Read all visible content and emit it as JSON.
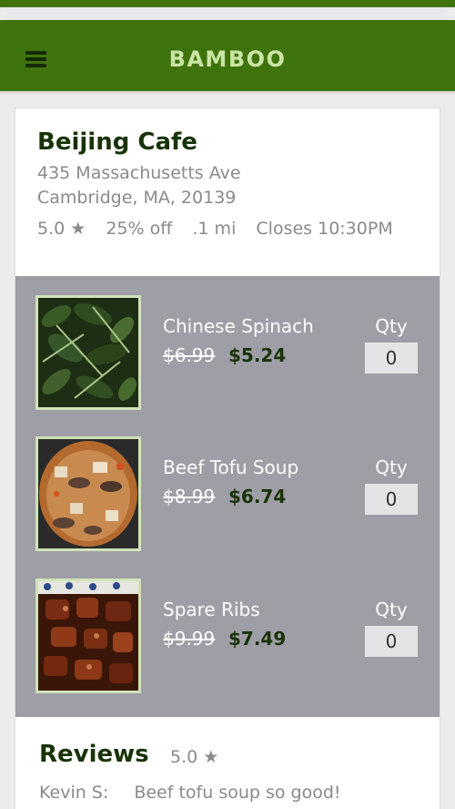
{
  "app": {
    "title": "BAMBOO"
  },
  "restaurant": {
    "name": "Beijing Cafe",
    "address_line1": "435 Massachusetts Ave",
    "address_line2": "Cambridge, MA, 20139",
    "rating": "5.0 ★",
    "discount": "25% off",
    "distance": ".1 mi",
    "hours": "Closes 10:30PM"
  },
  "menu": {
    "items": [
      {
        "name": "Chinese Spinach",
        "old_price": "$6.99",
        "new_price": "$5.24",
        "qty_label": "Qty",
        "qty": "0",
        "icon": "spinach-photo"
      },
      {
        "name": "Beef Tofu Soup",
        "old_price": "$8.99",
        "new_price": "$6.74",
        "qty_label": "Qty",
        "qty": "0",
        "icon": "soup-photo"
      },
      {
        "name": "Spare Ribs",
        "old_price": "$9.99",
        "new_price": "$7.49",
        "qty_label": "Qty",
        "qty": "0",
        "icon": "ribs-photo"
      }
    ]
  },
  "reviews": {
    "title": "Reviews",
    "rating": "5.0 ★",
    "entries": [
      {
        "author": "Kevin S:",
        "text": "Beef tofu soup so good!"
      }
    ]
  },
  "colors": {
    "brand": "#3f730d",
    "dark_green": "#183307",
    "panel": "#9f9ea6"
  }
}
